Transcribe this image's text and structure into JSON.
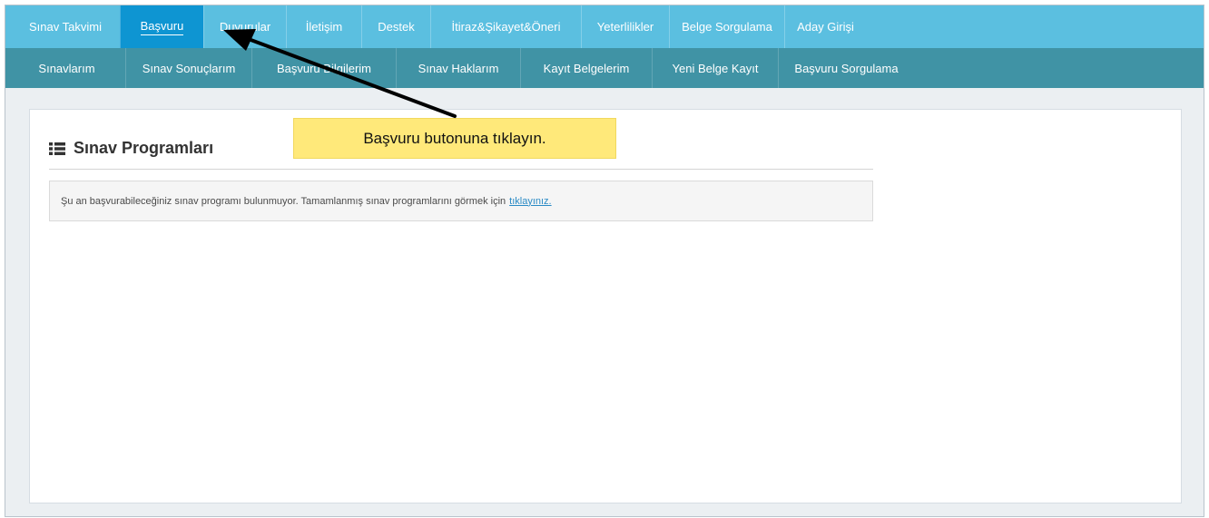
{
  "topnav": {
    "items": [
      {
        "label": "Sınav Takvimi",
        "active": false
      },
      {
        "label": "Başvuru",
        "active": true
      },
      {
        "label": "Duyurular",
        "active": false
      },
      {
        "label": "İletişim",
        "active": false
      },
      {
        "label": "Destek",
        "active": false
      },
      {
        "label": "İtiraz&Şikayet&Öneri",
        "active": false
      },
      {
        "label": "Yeterlilikler",
        "active": false
      },
      {
        "label": "Belge Sorgulama",
        "active": false
      },
      {
        "label": "Aday Girişi",
        "active": false
      }
    ]
  },
  "subnav": {
    "items": [
      {
        "label": "Sınavlarım"
      },
      {
        "label": "Sınav Sonuçlarım"
      },
      {
        "label": "Başvuru Bilgilerim"
      },
      {
        "label": "Sınav Haklarım"
      },
      {
        "label": "Kayıt Belgelerim"
      },
      {
        "label": "Yeni Belge Kayıt"
      },
      {
        "label": "Başvuru Sorgulama"
      }
    ]
  },
  "panel": {
    "title": "Sınav Programları",
    "icon": "list-icon",
    "notice_text": "Şu an başvurabileceğiniz sınav programı bulunmuyor. Tamamlanmış sınav programlarını görmek için",
    "notice_link": "tıklayınız."
  },
  "annotation": {
    "text": "Başvuru butonuna tıklayın."
  },
  "colors": {
    "topnav": "#5bbfe0",
    "topnav_active": "#0e95d2",
    "subnav": "#4093a5",
    "tooltip": "#ffe97a"
  }
}
